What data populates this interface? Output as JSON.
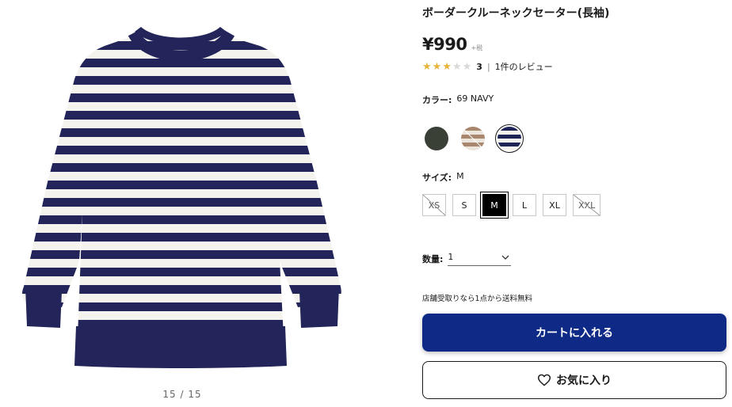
{
  "product": {
    "title": "ボーダークルーネックセーター(長袖)",
    "price": "¥990",
    "tax_note": "+税",
    "rating": {
      "score": 3,
      "max": 5,
      "score_text": "3",
      "separator": "|",
      "review_text": "1件のレビュー"
    },
    "color": {
      "label": "カラー:",
      "value": "69 NAVY",
      "swatches": [
        {
          "name": "dark-green",
          "color": "#3a4036",
          "selected": false
        },
        {
          "name": "beige-brown-stripe",
          "color": "#b89a86",
          "selected": false
        },
        {
          "name": "navy-white-stripe",
          "color": "#1f2457",
          "selected": true
        }
      ]
    },
    "size": {
      "label": "サイズ:",
      "value": "M",
      "options": [
        {
          "label": "XS",
          "state": "soldout"
        },
        {
          "label": "S",
          "state": "available"
        },
        {
          "label": "M",
          "state": "selected"
        },
        {
          "label": "L",
          "state": "available"
        },
        {
          "label": "XL",
          "state": "available"
        },
        {
          "label": "XXL",
          "state": "soldout"
        }
      ]
    },
    "quantity": {
      "label": "数量:",
      "value": "1"
    },
    "shipping_note": "店舗受取りなら1点から送料無料",
    "cart_button": "カートに入れる",
    "favorite_button": "お気に入り",
    "colors": {
      "cart": "#0e2a86",
      "navy": "#23255a",
      "star": "#e8b53c"
    }
  },
  "gallery": {
    "counter": "15 / 15"
  }
}
